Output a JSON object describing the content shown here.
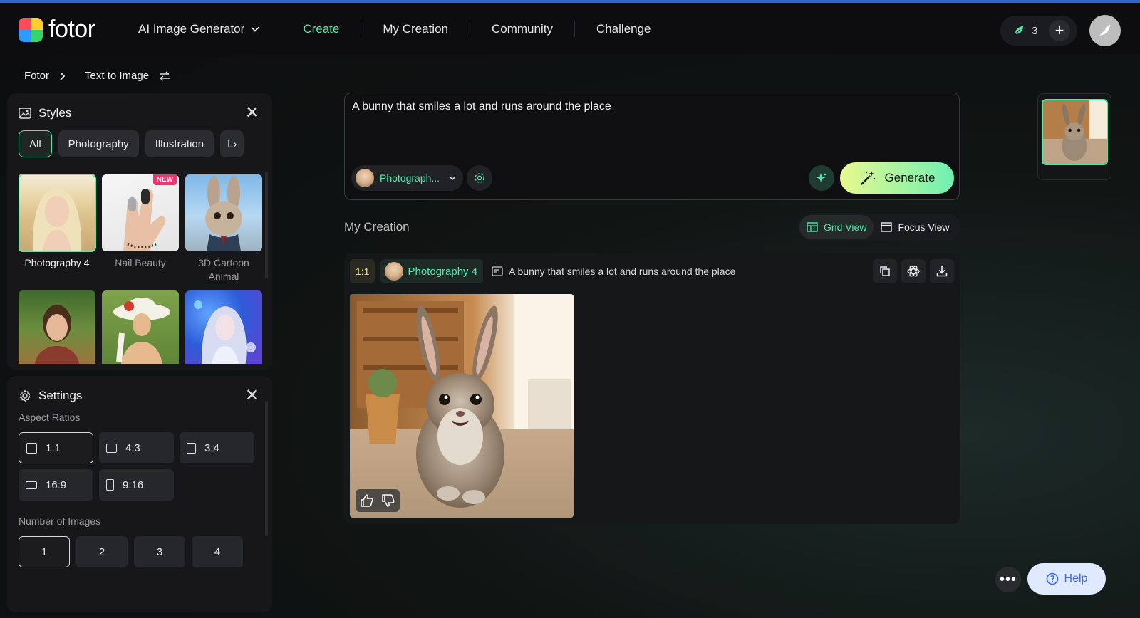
{
  "header": {
    "brand": "fotor",
    "nav": [
      {
        "label": "AI Image Generator",
        "dropdown": true
      },
      {
        "label": "Create",
        "active": true
      },
      {
        "label": "My Creation"
      },
      {
        "label": "Community"
      },
      {
        "label": "Challenge"
      }
    ],
    "credits": "3"
  },
  "breadcrumb": {
    "home": "Fotor",
    "current": "Text to Image"
  },
  "styles": {
    "title": "Styles",
    "chips": [
      "All",
      "Photography",
      "Illustration",
      "L"
    ],
    "cards": [
      {
        "name": "Photography 4",
        "selected": true
      },
      {
        "name": "Nail Beauty",
        "badge": "NEW"
      },
      {
        "name": "3D Cartoon Animal"
      },
      {
        "name": ""
      },
      {
        "name": ""
      },
      {
        "name": ""
      }
    ]
  },
  "settings": {
    "title": "Settings",
    "aspect_label": "Aspect Ratios",
    "aspect_ratios": [
      "1:1",
      "4:3",
      "3:4",
      "16:9",
      "9:16"
    ],
    "selected_ratio": "1:1",
    "count_label": "Number of Images",
    "counts": [
      "1",
      "2",
      "3",
      "4"
    ],
    "selected_count": "1"
  },
  "prompt": {
    "text": "A bunny that smiles a lot and runs around the place",
    "style_label": "Photograph...",
    "generate_label": "Generate"
  },
  "creation": {
    "title": "My Creation",
    "grid_view": "Grid View",
    "focus_view": "Focus View",
    "ratio": "1:1",
    "style": "Photography 4",
    "prompt": "A bunny that smiles a lot and runs around the place"
  },
  "help": {
    "label": "Help"
  },
  "colors": {
    "accent": "#52e8a8",
    "generate_start": "#e9f98f",
    "generate_end": "#6ef0b2",
    "help_bg": "#dfe9ff"
  }
}
